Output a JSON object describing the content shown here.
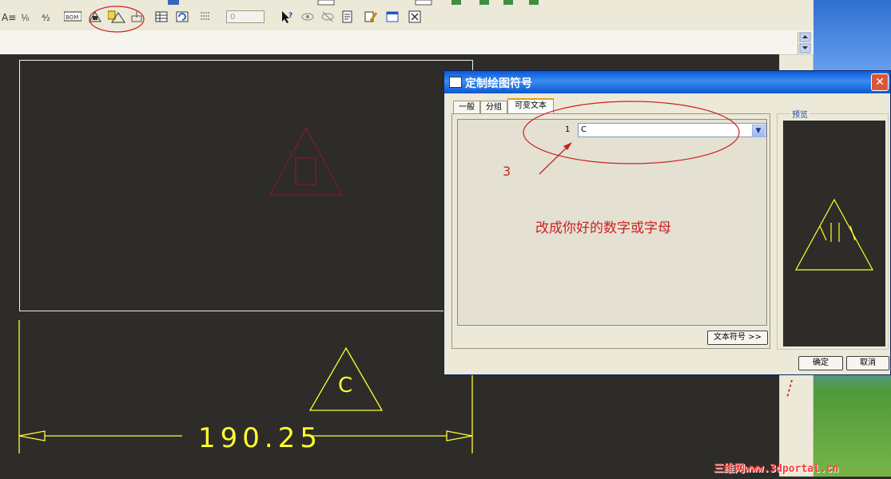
{
  "toolbar": {
    "number_field_value": "0",
    "icons": [
      "scale-icon",
      "tolerance-icon",
      "bom-icon",
      "symbol-icon",
      "custom-symbol-icon",
      "symbol-edit-icon",
      "table-icon",
      "refresh-icon",
      "hatch-icon",
      "help-cursor-icon",
      "eye-icon",
      "hide-icon",
      "doc-icon",
      "edit-icon",
      "window-icon",
      "close-box-icon"
    ]
  },
  "dimension": {
    "value": "190.25"
  },
  "symbol_on_drawing": {
    "text": "C"
  },
  "dialog": {
    "title": "定制绘图符号",
    "close_label": "✕",
    "tabs": [
      "一般",
      "分组",
      "可变文本"
    ],
    "active_tab": "可变文本",
    "row_number": "1",
    "value": "C",
    "text_symbol_button": "文本符号 >>",
    "preview_label": "预览",
    "ok_button": "确定",
    "cancel_button": "取消"
  },
  "annotations": {
    "step_number": "3",
    "hint": "改成你好的数字或字母"
  },
  "watermark": "三维网www.3dportal.cn",
  "colors": {
    "drawing_bg": "#2e2c28",
    "drawing_line": "#ffff33",
    "annotation_red": "#cc2222"
  }
}
